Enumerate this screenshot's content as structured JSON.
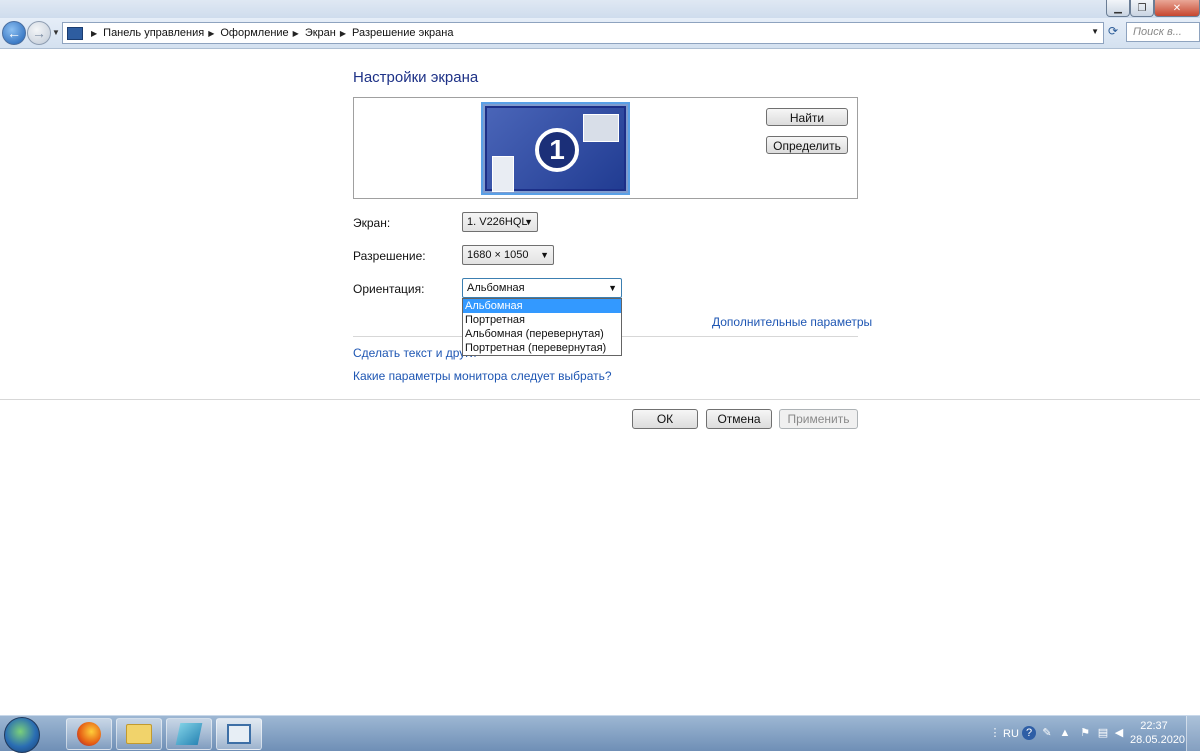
{
  "nav": {
    "breadcrumb": [
      "Панель управления",
      "Оформление",
      "Экран",
      "Разрешение экрана"
    ],
    "search_placeholder": "Поиск в..."
  },
  "main": {
    "heading": "Настройки экрана",
    "monitor_number": "1",
    "find_button": "Найти",
    "identify_button": "Определить",
    "display_label": "Экран:",
    "display_value": "1. V226HQL",
    "resolution_label": "Разрешение:",
    "resolution_value": "1680 × 1050",
    "orientation_label": "Ориентация:",
    "orientation_value": "Альбомная",
    "orientation_options": [
      "Альбомная",
      "Портретная",
      "Альбомная (перевернутая)",
      "Портретная (перевернутая)"
    ],
    "orientation_selected_index": 0,
    "advanced_link": "Дополнительные параметры",
    "text_size_link": "Сделать текст и други",
    "help_link": "Какие параметры монитора следует выбрать?",
    "ok_button": "ОК",
    "cancel_button": "Отмена",
    "apply_button": "Применить",
    "apply_enabled": false
  },
  "taskbar": {
    "language": "RU",
    "time": "22:37",
    "date": "28.05.2020"
  },
  "colors": {
    "heading": "#1e3287",
    "link": "#1e56b3",
    "selection": "#3399ff"
  }
}
